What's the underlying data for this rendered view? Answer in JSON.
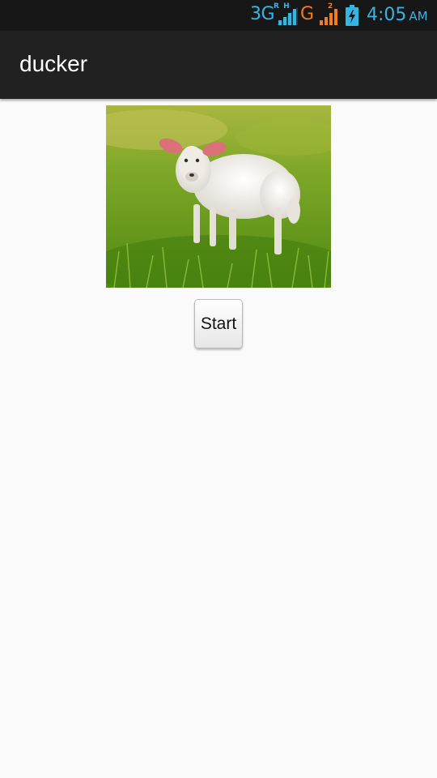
{
  "status_bar": {
    "sim1_network": "3G",
    "sim1_roaming": "R H",
    "sim1_slot": "1",
    "sim2_network": "G",
    "sim2_slot": "2",
    "time": "4:05",
    "ampm": "AM",
    "colors": {
      "sim1": "#33b5e5",
      "sim2": "#f47b20",
      "clock": "#33b5e5"
    },
    "icons": [
      "signal-bars-icon",
      "battery-charging-icon"
    ]
  },
  "action_bar": {
    "title": "ducker"
  },
  "main": {
    "image": {
      "subject": "lamb-in-grass"
    },
    "start_button": {
      "label": "Start"
    }
  }
}
